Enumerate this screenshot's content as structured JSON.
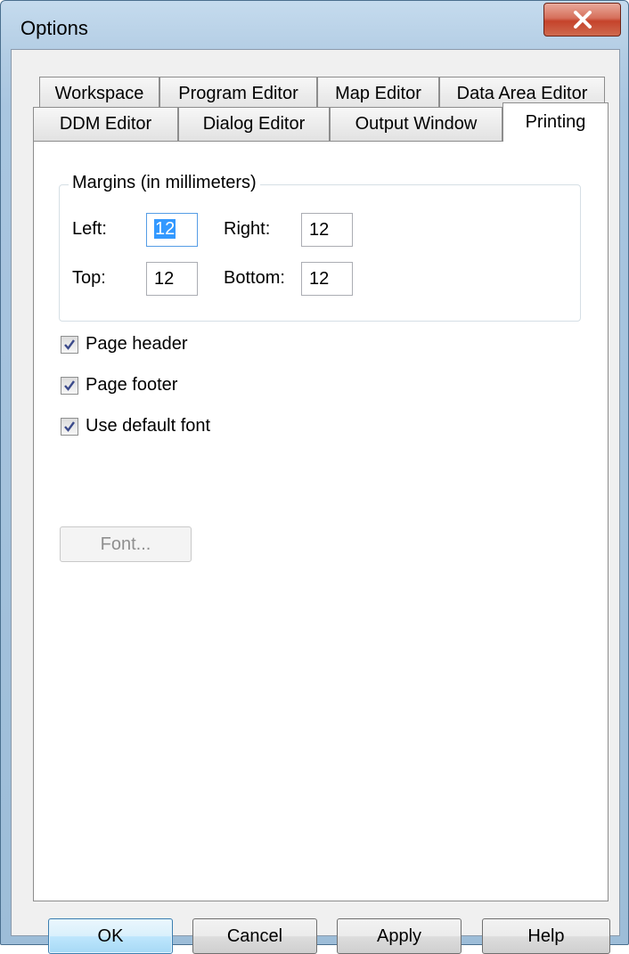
{
  "window": {
    "title": "Options",
    "close_glyph": "X"
  },
  "tabs": {
    "row1": [
      "Workspace",
      "Program Editor",
      "Map Editor",
      "Data Area Editor"
    ],
    "row2": [
      "DDM Editor",
      "Dialog Editor",
      "Output Window",
      "Printing"
    ],
    "active": "Printing"
  },
  "margins": {
    "legend": "Margins (in millimeters)",
    "left_label": "Left:",
    "left_value": "12",
    "right_label": "Right:",
    "right_value": "12",
    "top_label": "Top:",
    "top_value": "12",
    "bottom_label": "Bottom:",
    "bottom_value": "12"
  },
  "options": {
    "page_header": {
      "label": "Page header",
      "checked": true
    },
    "page_footer": {
      "label": "Page footer",
      "checked": true
    },
    "use_default_font": {
      "label": "Use default font",
      "checked": true
    }
  },
  "font_button": {
    "label": "Font...",
    "enabled": false
  },
  "buttons": {
    "ok": "OK",
    "cancel": "Cancel",
    "apply": "Apply",
    "help": "Help"
  },
  "colors": {
    "selection": "#3399ff",
    "close_button": "#c5432b",
    "default_button_border": "#3c7fb1",
    "check_mark": "#3b4a8a"
  }
}
